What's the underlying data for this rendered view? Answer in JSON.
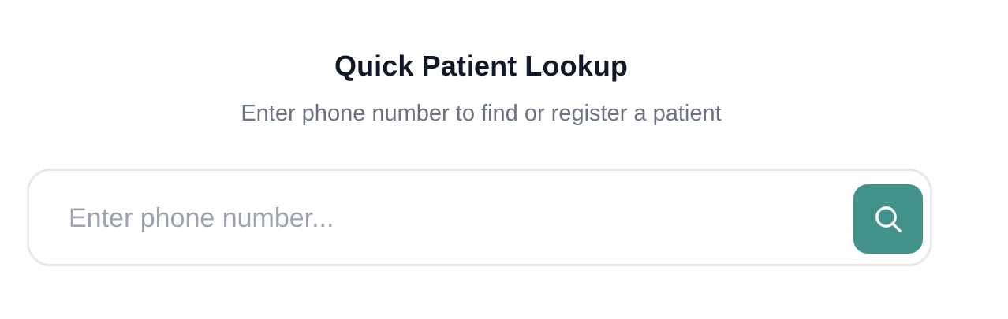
{
  "lookup": {
    "title": "Quick Patient Lookup",
    "subtitle": "Enter phone number to find or register a patient",
    "phone_input": {
      "value": "",
      "placeholder": "Enter phone number..."
    },
    "search_button": {
      "icon": "search-icon"
    }
  },
  "colors": {
    "title": "#111827",
    "subtitle": "#6b7280",
    "placeholder": "#9ca3af",
    "input_border": "#e5e7eb",
    "accent": "#43928a",
    "icon": "#ffffff"
  }
}
